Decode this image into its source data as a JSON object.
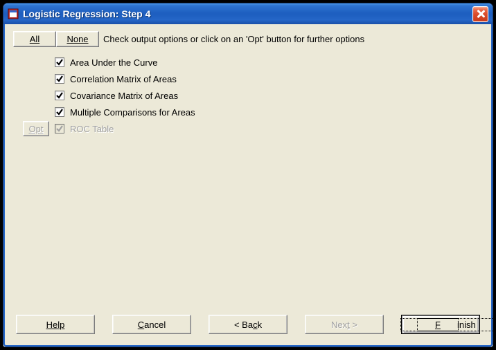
{
  "window": {
    "title": "Logistic Regression: Step 4"
  },
  "toolbar": {
    "all_label": "All",
    "none_label": "None",
    "hint": "Check output options or click on an 'Opt' button for further options"
  },
  "opt_button_label": "Opt",
  "options": [
    {
      "label": "Area Under the Curve",
      "checked": true,
      "enabled": true,
      "has_opt": false
    },
    {
      "label": "Correlation Matrix of Areas",
      "checked": true,
      "enabled": true,
      "has_opt": false
    },
    {
      "label": "Covariance Matrix of Areas",
      "checked": true,
      "enabled": true,
      "has_opt": false
    },
    {
      "label": "Multiple Comparisons for Areas",
      "checked": true,
      "enabled": true,
      "has_opt": false
    },
    {
      "label": "ROC Table",
      "checked": true,
      "enabled": false,
      "has_opt": true
    }
  ],
  "buttons": {
    "help": "Help",
    "cancel": "Cancel",
    "back": "Back",
    "back_prefix": "< ",
    "next": "Next",
    "next_suffix": " >",
    "finish": "Finish",
    "next_enabled": false
  }
}
